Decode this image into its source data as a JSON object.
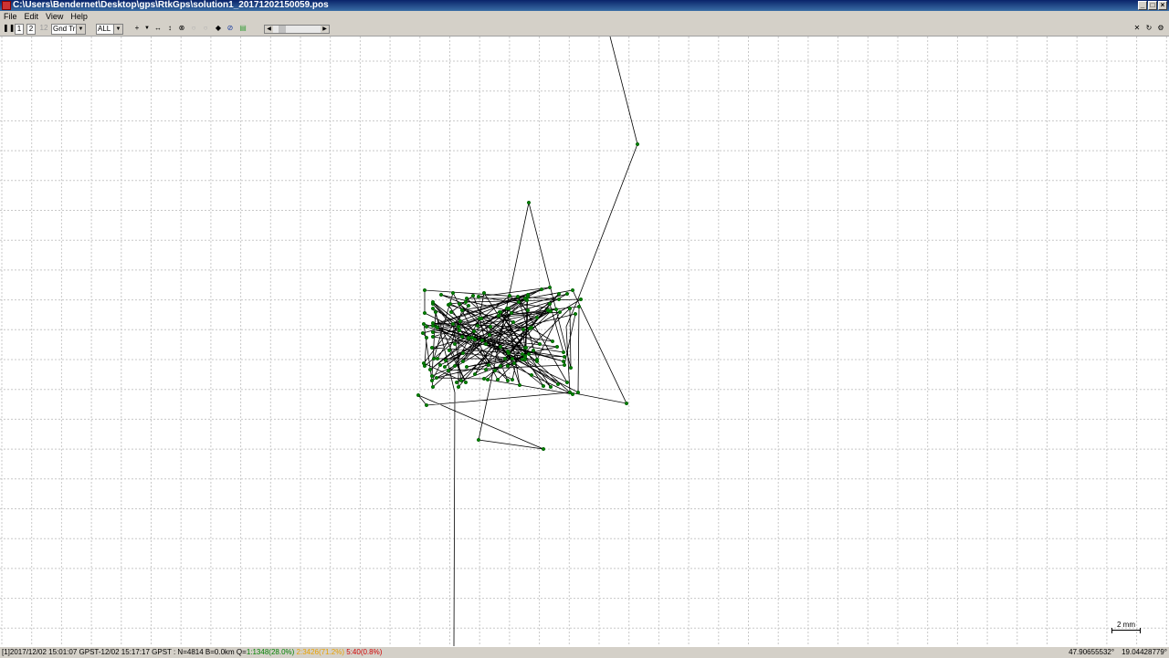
{
  "window": {
    "title": "C:\\Users\\Bendernet\\Desktop\\gps\\RtkGps\\solution1_20171202150059.pos"
  },
  "menu": [
    "File",
    "Edit",
    "View",
    "Help"
  ],
  "toolbar": {
    "buttons": [
      "1",
      "2",
      "12"
    ],
    "plot_type": "Gnd Trk",
    "quality_filter": "ALL"
  },
  "plot": {
    "scale_label": "2 mm",
    "grid": "dotted",
    "track_color": "#000000",
    "point_color": "#008000"
  },
  "status": {
    "prefix": "[1]2017/12/02 15:01:07 GPST-12/02 15:17:17 GPST : N=4814 B=0.0km Q=",
    "q1": "1:1348(28.0%)",
    "q2": "2:3426(71.2%)",
    "q5": "5:40(0.8%)",
    "lat": "47.90655532°",
    "lon": "19.04428779°"
  },
  "colors": {
    "title_bar": "#0a246a",
    "chrome": "#d4d0c8",
    "fix": "#008000",
    "float": "#e8a000",
    "single": "#d00000"
  }
}
